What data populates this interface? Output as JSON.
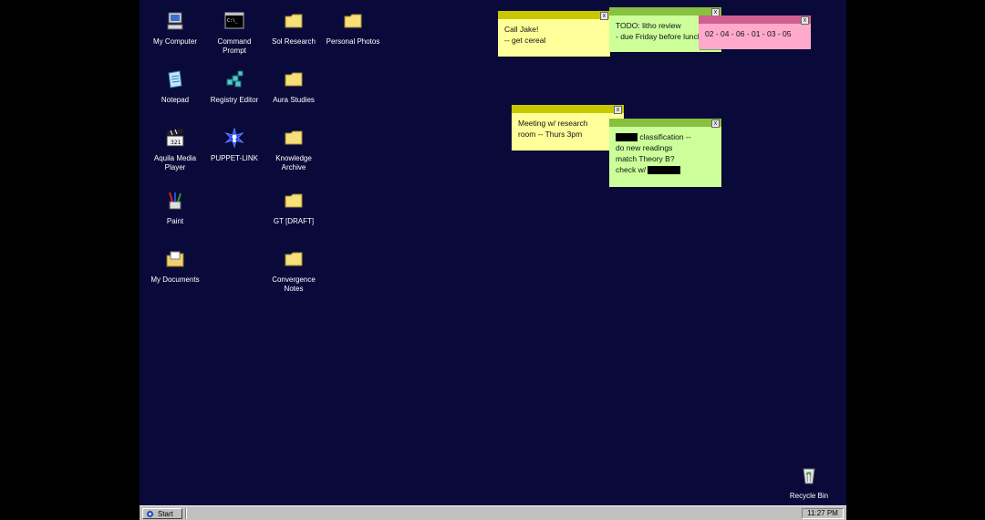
{
  "desktop_icons": {
    "my_computer": "My Computer",
    "command_prompt": "Command Prompt",
    "sol_research": "Sol Research",
    "personal_photos": "Personal Photos",
    "notepad": "Notepad",
    "registry_editor": "Registry Editor",
    "aura_studies": "Aura Studies",
    "aquila_media_player": "Aquila Media Player",
    "puppet_link": "PUPPET-LINK",
    "knowledge_archive": "Knowledge Archive",
    "paint": "Paint",
    "gt_draft": "GT [DRAFT]",
    "my_documents": "My Documents",
    "convergence_notes": "Convergence Notes",
    "recycle_bin": "Recycle Bin"
  },
  "notes": {
    "call_jake": {
      "line1": "Call Jake!",
      "line2": "-- get cereal",
      "color": "#ffff99",
      "bar": "#c8c800"
    },
    "todo": {
      "line1": "TODO: litho review",
      "line2": "- due Friday before lunch",
      "color": "#ccff99",
      "bar": "#88c040"
    },
    "numbers": {
      "line1": "02 - 04 - 06 - 01 - 03 - 05",
      "color": "#ffaacc",
      "bar": "#d06090"
    },
    "meeting": {
      "line1": "Meeting w/ research",
      "line2": "room -- Thurs 3pm",
      "color": "#ffff99",
      "bar": "#c8c800"
    },
    "classification": {
      "line1": "classification --",
      "line2": "do new readings",
      "line3": "match Theory B?",
      "line4": "check w/",
      "color": "#ccff99",
      "bar": "#88c040"
    }
  },
  "note_close_glyph": "x",
  "taskbar": {
    "start_label": "Start",
    "clock": "11:27 PM"
  }
}
